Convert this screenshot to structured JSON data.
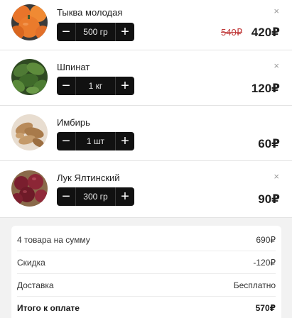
{
  "items": [
    {
      "name": "Тыква молодая",
      "qty": "500 гр",
      "old_price": "540₽",
      "price": "420₽",
      "minus": "−",
      "plus": "+",
      "remove": "×",
      "icon": "pumpkin-image"
    },
    {
      "name": "Шпинат",
      "qty": "1 кг",
      "price": "120₽",
      "minus": "−",
      "plus": "+",
      "remove": "×",
      "icon": "spinach-image"
    },
    {
      "name": "Имбирь",
      "qty": "1 шт",
      "price": "60₽",
      "minus": "−",
      "plus": "+",
      "remove": "×",
      "icon": "ginger-image"
    },
    {
      "name": "Лук Ялтинский",
      "qty": "300 гр",
      "price": "90₽",
      "minus": "−",
      "plus": "+",
      "remove": "×",
      "icon": "onion-image"
    }
  ],
  "summary": {
    "items_label": "4 товара на сумму",
    "items_value": "690₽",
    "discount_label": "Скидка",
    "discount_value": "-120₽",
    "delivery_label": "Доставка",
    "delivery_value": "Бесплатно",
    "total_label": "Итого к оплате",
    "total_value": "570₽"
  },
  "colors": {
    "stepper_bg": "#111111",
    "old_price": "#c03a3a",
    "page_bg": "#f2f2f2"
  }
}
